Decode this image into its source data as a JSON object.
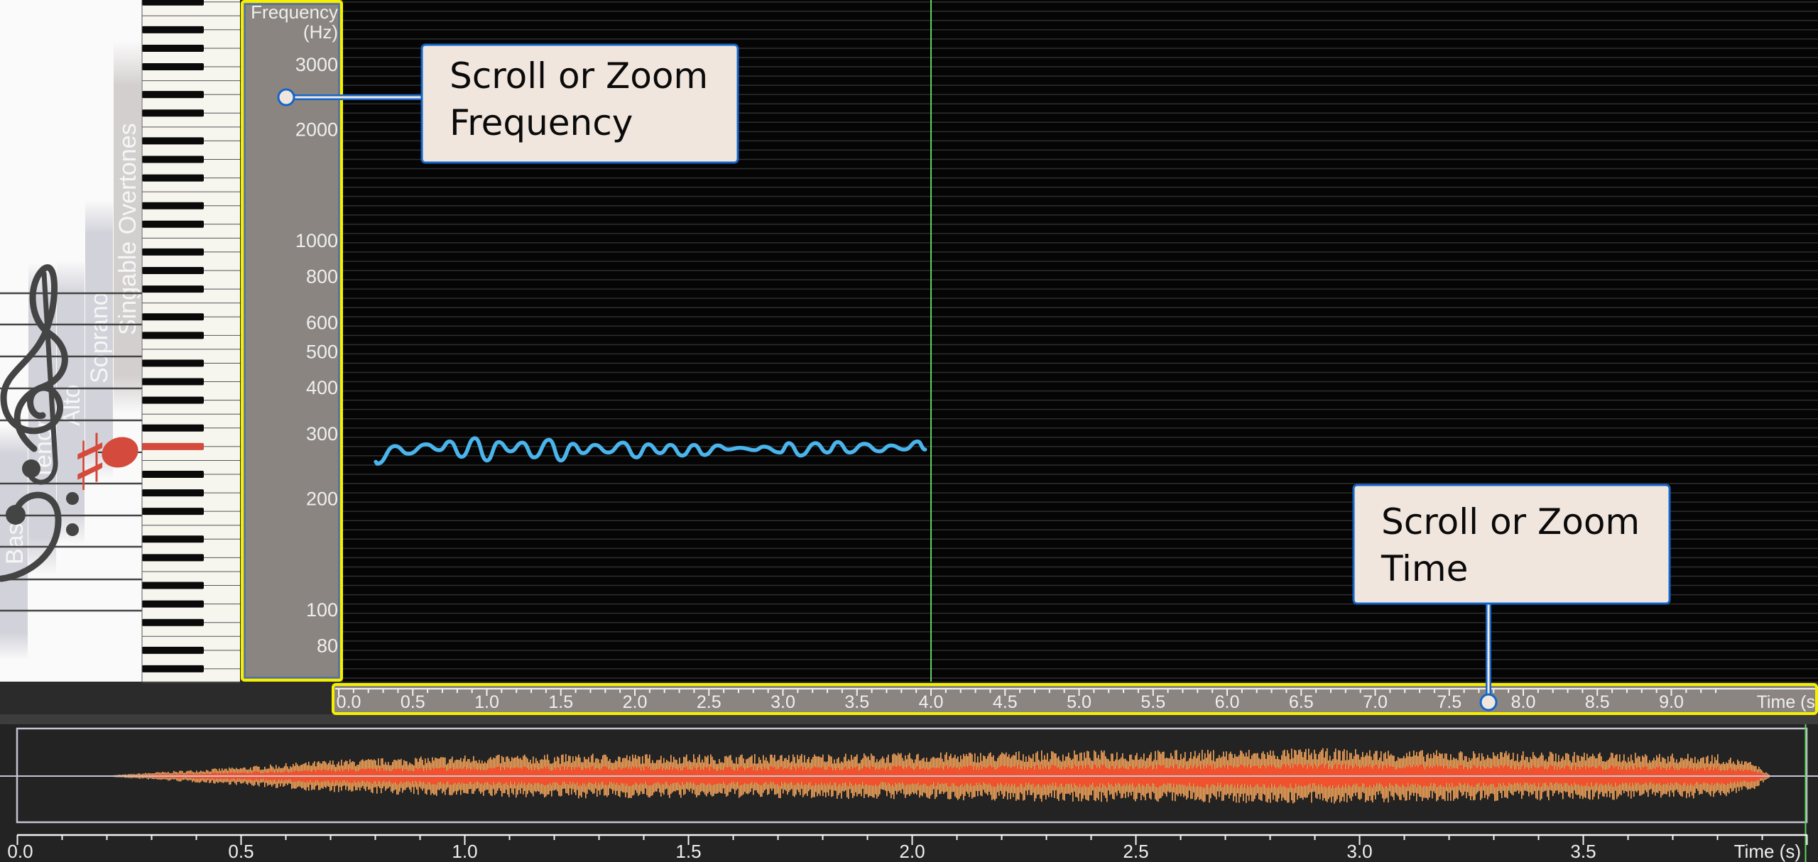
{
  "colors": {
    "plot_bg": "#050505",
    "grid": "#2e2e2e",
    "axis_panel": "#8a8580",
    "highlight_border": "#f5f000",
    "pitch_line": "#4ab4ec",
    "playhead": "#5fd35f",
    "callout_fill": "#f1e6de",
    "callout_border": "#1565c8",
    "note": "#d44a3c",
    "wave_outer": "#f6a55a",
    "wave_inner": "#f2512e"
  },
  "staff": {
    "voice_ranges": [
      "Bass",
      "Tenor",
      "Alto",
      "Soprano",
      "Singable Overtones"
    ],
    "clefs": [
      "treble-clef-icon",
      "bass-clef-icon"
    ],
    "current_note": {
      "name": "C#4",
      "accidental": "♯"
    }
  },
  "frequency_axis": {
    "title_line1": "Frequency",
    "title_line2": "(Hz)",
    "scale": "log",
    "ticks": [
      "3000",
      "2000",
      "1000",
      "800",
      "600",
      "500",
      "400",
      "300",
      "200",
      "100",
      "80"
    ]
  },
  "time_ruler": {
    "ticks": [
      "0.0",
      "0.5",
      "1.0",
      "1.5",
      "2.0",
      "2.5",
      "3.0",
      "3.5",
      "4.0",
      "4.5",
      "5.0",
      "5.5",
      "6.0",
      "6.5",
      "7.0",
      "7.5",
      "8.0",
      "8.5",
      "9.0"
    ],
    "unit_label": "Time (s"
  },
  "waveform_axis": {
    "ticks": [
      "0.0",
      "0.5",
      "1.0",
      "1.5",
      "2.0",
      "2.5",
      "3.0",
      "3.5"
    ],
    "unit_label": "Time (s)"
  },
  "callouts": {
    "frequency": {
      "line1": "Scroll or Zoom",
      "line2": "Frequency"
    },
    "time": {
      "line1": "Scroll or Zoom",
      "line2": "Time"
    }
  },
  "chart_data": {
    "type": "line",
    "xlabel": "Time (s)",
    "ylabel": "Frequency (Hz)",
    "xlim": [
      0,
      9.4
    ],
    "ylim": [
      70,
      3500
    ],
    "y_scale": "log",
    "grid": "semitone",
    "playhead_time": 4.0,
    "pitch_contour": {
      "time": [
        0.25,
        0.26,
        0.38,
        0.47,
        0.59,
        0.68,
        0.75,
        0.83,
        0.92,
        1.0,
        1.08,
        1.16,
        1.24,
        1.32,
        1.42,
        1.5,
        1.58,
        1.65,
        1.73,
        1.82,
        1.92,
        2.01,
        2.09,
        2.17,
        2.24,
        2.32,
        2.4,
        2.47,
        2.56,
        2.63,
        2.71,
        2.81,
        2.87,
        2.98,
        3.04,
        3.12,
        3.22,
        3.3,
        3.37,
        3.45,
        3.55,
        3.65,
        3.73,
        3.82,
        3.91,
        3.96
      ],
      "hz": [
        252,
        249,
        278,
        265,
        281,
        271,
        286,
        260,
        292,
        254,
        285,
        269,
        284,
        259,
        289,
        254,
        282,
        266,
        280,
        267,
        284,
        259,
        281,
        266,
        280,
        262,
        280,
        263,
        279,
        272,
        275,
        271,
        277,
        267,
        283,
        262,
        283,
        267,
        285,
        267,
        282,
        269,
        279,
        272,
        286,
        272
      ]
    },
    "waveform": {
      "duration": 4.0,
      "envelope_time": [
        0.21,
        0.3,
        0.5,
        0.7,
        1.0,
        1.3,
        1.6,
        2.0,
        2.3,
        2.6,
        2.9,
        3.2,
        3.5,
        3.8,
        3.88,
        3.92
      ],
      "envelope_amp": [
        0.02,
        0.08,
        0.2,
        0.35,
        0.45,
        0.48,
        0.47,
        0.5,
        0.55,
        0.56,
        0.6,
        0.55,
        0.52,
        0.47,
        0.3,
        0.0
      ]
    }
  }
}
